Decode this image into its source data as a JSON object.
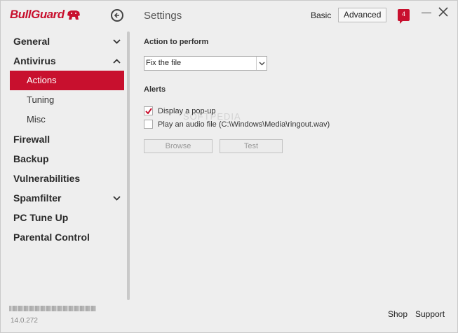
{
  "header": {
    "logo_text": "BullGuard",
    "title": "Settings",
    "mode_basic": "Basic",
    "mode_advanced": "Advanced",
    "notification_count": "4",
    "brand_color": "#c8102e"
  },
  "sidebar": {
    "items": [
      {
        "label": "General",
        "chevron": "down"
      },
      {
        "label": "Antivirus",
        "chevron": "up"
      },
      {
        "label": "Actions",
        "sub": true,
        "active": true
      },
      {
        "label": "Tuning",
        "sub": true
      },
      {
        "label": "Misc",
        "sub": true
      },
      {
        "label": "Firewall"
      },
      {
        "label": "Backup"
      },
      {
        "label": "Vulnerabilities"
      },
      {
        "label": "Spamfilter",
        "chevron": "down"
      },
      {
        "label": "PC Tune Up"
      },
      {
        "label": "Parental Control"
      }
    ],
    "version": "14.0.272"
  },
  "main": {
    "action_heading": "Action to perform",
    "action_value": "Fix the file",
    "alerts_heading": "Alerts",
    "popup_label": "Display a pop-up",
    "popup_checked": true,
    "audio_label": "Play an audio file (C:\\Windows\\Media\\ringout.wav)",
    "audio_checked": false,
    "browse_label": "Browse",
    "test_label": "Test"
  },
  "watermark": "SOFTPEDIA",
  "footer": {
    "shop": "Shop",
    "support": "Support"
  }
}
